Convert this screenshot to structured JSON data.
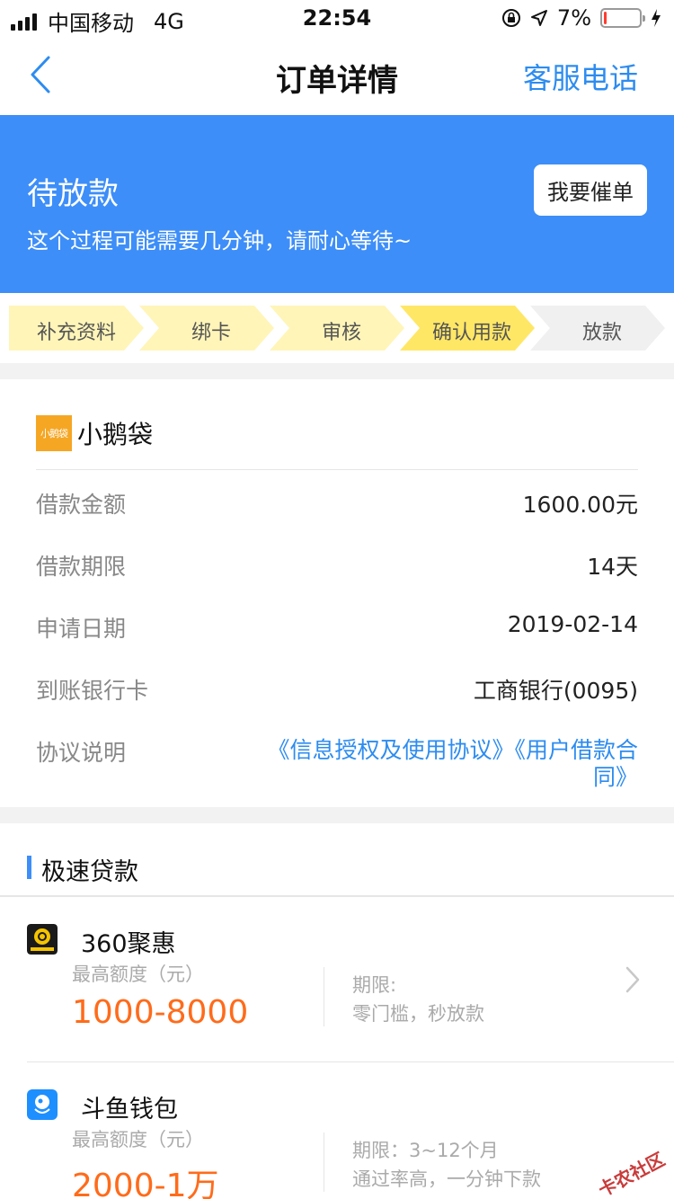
{
  "status_bar": {
    "carrier": "中国移动",
    "network": "4G",
    "time": "22:54",
    "battery_percent": "7%",
    "battery_level": 0.07
  },
  "nav": {
    "title": "订单详情",
    "action_label": "客服电话",
    "back_icon": "chevron-left-icon"
  },
  "banner": {
    "title": "待放款",
    "subtitle": "这个过程可能需要几分钟，请耐心等待~",
    "button_label": "我要催单"
  },
  "steps": [
    {
      "label": "补充资料",
      "state": "done"
    },
    {
      "label": "绑卡",
      "state": "done"
    },
    {
      "label": "审核",
      "state": "done"
    },
    {
      "label": "确认用款",
      "state": "current"
    },
    {
      "label": "放款",
      "state": "pending"
    }
  ],
  "order": {
    "lender_logo_text": "小鹅袋",
    "lender_name": "小鹅袋",
    "rows": [
      {
        "label": "借款金额",
        "value": "1600.00元"
      },
      {
        "label": "借款期限",
        "value": "14天"
      },
      {
        "label": "申请日期",
        "value": "2019-02-14"
      },
      {
        "label": "到账银行卡",
        "value": "工商银行(0095)"
      }
    ],
    "agreement_label": "协议说明",
    "agreement_links": [
      "《信息授权及使用协议》",
      "《用户借款合同》"
    ]
  },
  "speed_loans": {
    "title": "极速贷款",
    "items": [
      {
        "name": "360聚惠",
        "amount_label": "最高额度（元）",
        "amount": "1000-8000",
        "term": "期限:",
        "desc": "零门槛，秒放款",
        "logo_icon": "360-logo-icon"
      },
      {
        "name": "斗鱼钱包",
        "amount_label": "最高额度（元）",
        "amount": "2000-1万",
        "term": "期限：3~12个月",
        "desc": "通过率高，一分钟下款",
        "logo_icon": "douyu-logo-icon"
      }
    ]
  },
  "watermark": "卡农社区",
  "colors": {
    "brand_blue": "#3d8ef8",
    "link_blue": "#2d8cf0",
    "step_done": "#fff5b8",
    "step_current": "#ffe766",
    "step_pending": "#f0f0f0",
    "amount_orange": "#ff6b1a"
  }
}
